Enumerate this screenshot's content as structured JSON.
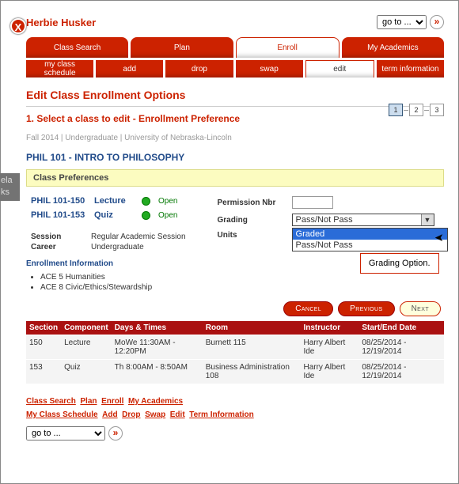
{
  "student": "Herbie Husker",
  "goto_label": "go to ...",
  "tabs_main": [
    "Class Search",
    "Plan",
    "Enroll",
    "My Academics"
  ],
  "tabs_main_active": 2,
  "tabs_sub": [
    "my class schedule",
    "add",
    "drop",
    "swap",
    "edit",
    "term information"
  ],
  "tabs_sub_active": 4,
  "page_title": "Edit Class Enrollment Options",
  "subtitle": "1.  Select a class to edit - Enrollment Preference",
  "steps": [
    "1",
    "2",
    "3"
  ],
  "step_active": 0,
  "meta": "Fall 2014 | Undergraduate | University of Nebraska-Lincoln",
  "course": "PHIL  101 - INTRO TO PHILOSOPHY",
  "prefs_title": "Class Preferences",
  "components": [
    {
      "code": "PHIL 101-150",
      "type": "Lecture",
      "status": "Open"
    },
    {
      "code": "PHIL 101-153",
      "type": "Quiz",
      "status": "Open"
    }
  ],
  "session": {
    "label": "Session",
    "value": "Regular Academic Session"
  },
  "career": {
    "label": "Career",
    "value": "Undergraduate"
  },
  "perm_label": "Permission Nbr",
  "perm_value": "",
  "grading_label": "Grading",
  "grading_selected": "Pass/Not Pass",
  "grading_options": [
    "Graded",
    "Pass/Not Pass"
  ],
  "grading_highlight": 0,
  "units_label": "Units",
  "callout": "Grading Option.",
  "enroll_info_title": "Enrollment Information",
  "enroll_info": [
    "ACE 5 Humanities",
    "ACE 8 Civic/Ethics/Stewardship"
  ],
  "btn_cancel": "Cancel",
  "btn_prev": "Previous",
  "btn_next": "Next",
  "table_headers": [
    "Section",
    "Component",
    "Days & Times",
    "Room",
    "Instructor",
    "Start/End Date"
  ],
  "rows": [
    {
      "section": "150",
      "component": "Lecture",
      "times": "MoWe 11:30AM - 12:20PM",
      "room": "Burnett 115",
      "instr": "Harry Albert Ide",
      "dates": "08/25/2014 - 12/19/2014"
    },
    {
      "section": "153",
      "component": "Quiz",
      "times": "Th 8:00AM - 8:50AM",
      "room": "Business Administration 108",
      "instr": "Harry Albert Ide",
      "dates": "08/25/2014 - 12/19/2014"
    }
  ],
  "links1": [
    "Class Search",
    "Plan",
    "Enroll",
    "My Academics"
  ],
  "links2": [
    "My Class Schedule",
    "Add",
    "Drop",
    "Swap",
    "Edit",
    "Term Information"
  ],
  "side_text": "ela\nks"
}
